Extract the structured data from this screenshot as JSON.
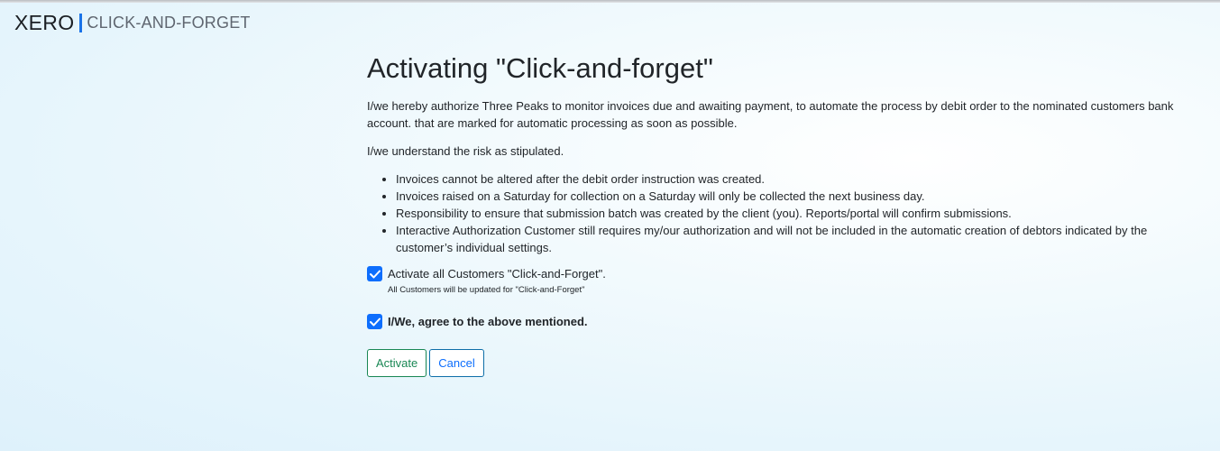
{
  "brand": {
    "name": "XERO",
    "subtitle": "CLICK-AND-FORGET"
  },
  "page": {
    "title": "Activating \"Click-and-forget\"",
    "paragraph1": "I/we hereby authorize Three Peaks to monitor invoices due and awaiting payment, to automate the process by debit order to the nominated customers bank account. that are marked for automatic processing as soon as possible.",
    "paragraph2": "I/we understand the risk as stipulated.",
    "bullets": [
      "Invoices cannot be altered after the debit order instruction was created.",
      "Invoices raised on a Saturday for collection on a Saturday will only be collected the next business day.",
      "Responsibility to ensure that submission batch was created by the client (you). Reports/portal will confirm submissions.",
      "Interactive Authorization Customer still requires my/our authorization and will not be included in the automatic creation of debtors indicated by the customer’s individual settings."
    ]
  },
  "form": {
    "activate_all": {
      "label": "Activate all Customers \"Click-and-Forget\".",
      "checked": true,
      "help": "All Customers will be updated for \"Click-and-Forget\""
    },
    "agree": {
      "label": "I/We, agree to the above mentioned.",
      "checked": true
    },
    "activate_label": "Activate",
    "cancel_label": "Cancel"
  },
  "colors": {
    "accent": "#1a73e8",
    "checkbox": "#0d6efd",
    "activate": "#198754",
    "cancel": "#0d6efd"
  },
  "icons": {
    "checkmark": "checkmark-icon"
  }
}
